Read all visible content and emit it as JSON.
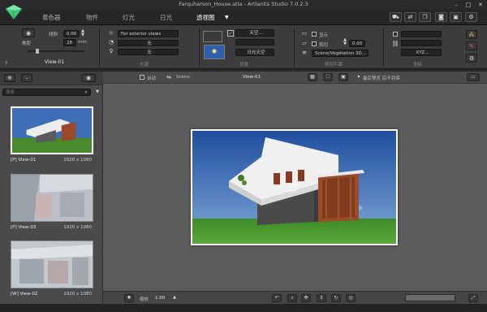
{
  "title_bar": {
    "title": "Farquharson_House.atla - Artlantis Studio 7.0.2.3"
  },
  "nav": {
    "tabs": [
      "着色器",
      "物件",
      "灯光",
      "日光",
      "透视图"
    ],
    "active_tab": "透视图",
    "dropdown_arrow": "▼"
  },
  "panel": {
    "help": "?",
    "view_name": "View-01",
    "focal_label": "焦距",
    "focal_value": "28",
    "focal_unit": "mm",
    "tilt_label": "倾斜",
    "tilt_value": "0.00",
    "render_preset": "For exterior views",
    "dropdown_2": "无",
    "dropdown_3": "无",
    "section_lighting": "光源",
    "sky_button": "天空...",
    "background_dropdown": "日光天空",
    "section_background": "背景",
    "show_label": "显示",
    "clip_label": "剪切",
    "clip_value": "0.00",
    "clip_section": "剪切平面",
    "veg_dropdown": "Scène/Végétation 3D...",
    "xyz_button": "XYZ...",
    "coords_section": "坐标"
  },
  "left_panel": {
    "search_placeholder": "搜索",
    "views": [
      {
        "name": "[P] View-01",
        "resolution": "1920 x 1080"
      },
      {
        "name": "[P] View-03",
        "resolution": "1920 x 1080"
      },
      {
        "name": "[W] View-02",
        "resolution": "1920 x 1080"
      }
    ]
  },
  "viewport_toolbar": {
    "auto_label": "自动",
    "scene_label": "Scène",
    "view_select": "View-01",
    "preview_label": "最后预览 后不到保"
  },
  "bottom_bar": {
    "scale_label": "缩放",
    "scale_value": "1.00"
  },
  "colors": {
    "accent": "#ffffff",
    "panel_bg": "#3c3c3c",
    "viewport_bg": "#5c5c5c",
    "logo_green": "#3fc77d"
  },
  "icons": [
    "logo-gem-icon",
    "camera-icon",
    "sun-icon",
    "spotlight-icon",
    "link-icon",
    "ruler-icon",
    "lock-icon",
    "color-icon",
    "gear-icon",
    "eye-icon",
    "search-icon",
    "export-icon",
    "window-icon",
    "photo-icon",
    "settings-icon",
    "undo-icon",
    "zoom-icon",
    "move-icon",
    "pan-icon",
    "rotate-icon"
  ]
}
